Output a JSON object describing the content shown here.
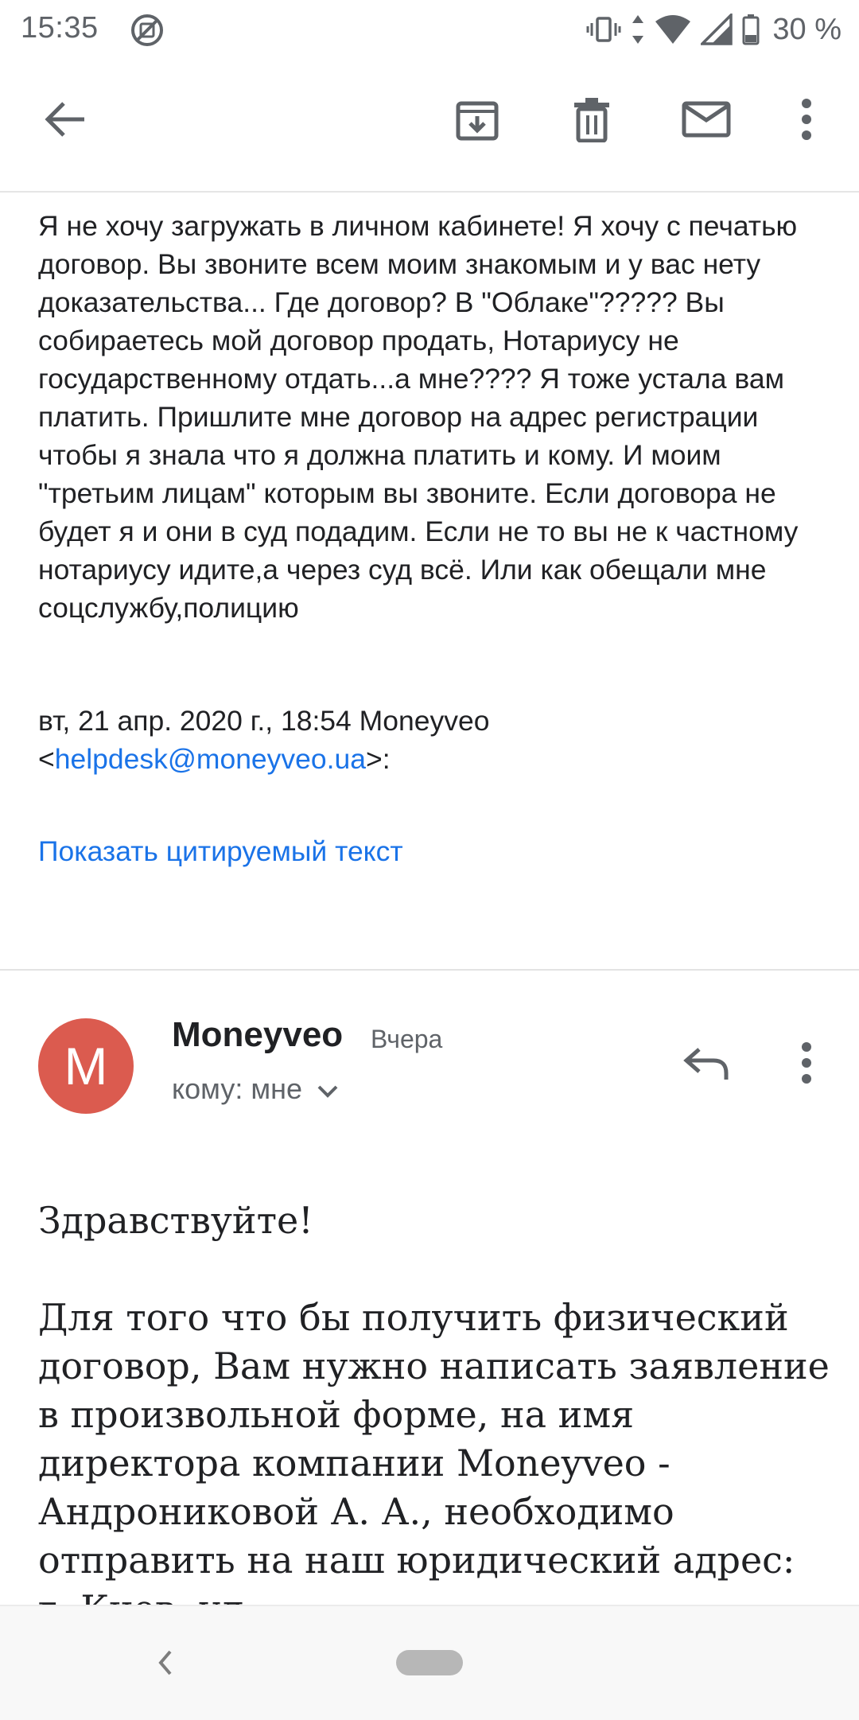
{
  "status_bar": {
    "time": "15:35",
    "battery_percent": "30 %"
  },
  "app_bar": {
    "icons": [
      "back-arrow-icon",
      "archive-icon",
      "delete-icon",
      "mark-unread-icon",
      "more-vert-icon"
    ]
  },
  "previous_message": {
    "body": "Я не хочу загружать в личном кабинете! Я хочу с печатью договор. Вы звоните всем моим знакомым и у вас нету доказательства... Где договор? В \"Облаке\"????? Вы собираетесь мой договор продать, Нотариусу не государственному отдать...а мне????  Я тоже устала вам платить. Пришлите мне договор на адрес регистрации чтобы я знала что я должна платить и кому. И моим \"третьим лицам\" которым вы звоните. Если договора не будет я и они в суд подадим. Если не то вы не к частному нотариусу идите,а через суд всё. Или как обещали мне соцслужбу,полицию",
    "quote_header_prefix": "вт, 21 апр. 2020 г., 18:54 Moneyveo",
    "quote_email_open": "<",
    "quote_email": "helpdesk@moneyveo.ua",
    "quote_email_close": ">:",
    "show_quoted_label": "Показать цитируемый текст"
  },
  "message": {
    "avatar_letter": "M",
    "avatar_color": "#db5b4f",
    "sender": "Moneyveo",
    "date": "Вчера",
    "recipient": "кому: мне",
    "greeting": "Здравствуйте!",
    "body": "Для того что бы получить физический договор, Вам нужно написать заявление в произвольной форме, на имя директора компании Moneyveo - Андрониковой А. А., необходимо отправить на наш юридический адрес: г. Киев, ул."
  },
  "colors": {
    "link": "#1a73e8",
    "text": "#202124",
    "secondary": "#5f6368"
  }
}
